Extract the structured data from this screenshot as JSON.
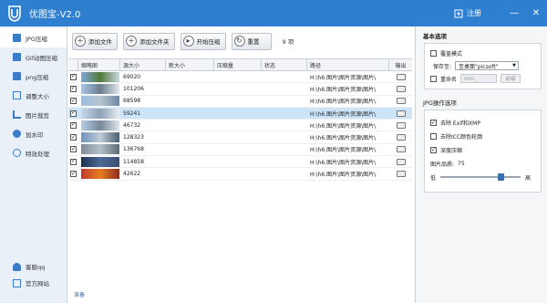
{
  "titlebar": {
    "title": "优图宝-V2.0",
    "register_label": "注册",
    "minimize": "—",
    "close": "✕",
    "bg_color": "#2e7fd0"
  },
  "sidebar": {
    "items": [
      {
        "label": "JPG压缩",
        "icon": "image-icon"
      },
      {
        "label": "Gif动图压缩",
        "icon": "gif-icon"
      },
      {
        "label": "png压缩",
        "icon": "image-icon"
      },
      {
        "label": "调整大小",
        "icon": "resize-icon"
      },
      {
        "label": "图片裁剪",
        "icon": "crop-icon"
      },
      {
        "label": "加水印",
        "icon": "watermark-icon"
      },
      {
        "label": "特效处理",
        "icon": "effect-icon"
      }
    ],
    "bottom": [
      {
        "label": "客服qq",
        "icon": "user-icon"
      },
      {
        "label": "官方网站",
        "icon": "computer-icon"
      }
    ]
  },
  "toolbar": {
    "add_file": "添加文件",
    "add_folder": "添加文件夹",
    "start": "开始压缩",
    "reset": "重置",
    "count": "9 项"
  },
  "table": {
    "headers": [
      "缩略图",
      "源大小",
      "新大小",
      "压缩量",
      "状态",
      "路径",
      "输出"
    ],
    "rows": [
      {
        "src": "69020",
        "path": "H:\\h6.图片\\图片资源\\图片\\"
      },
      {
        "src": "101206",
        "path": "H:\\h6.图片\\图片资源\\图片\\"
      },
      {
        "src": "68598",
        "path": "H:\\h6.图片\\图片资源\\图片\\"
      },
      {
        "src": "59241",
        "path": "H:\\h6.图片\\图片资源\\图片\\"
      },
      {
        "src": "46732",
        "path": "H:\\h6.图片\\图片资源\\图片\\"
      },
      {
        "src": "128323",
        "path": "H:\\h6.图片\\图片资源\\图片\\"
      },
      {
        "src": "136768",
        "path": "H:\\h6.图片\\图片资源\\图片\\"
      },
      {
        "src": "114858",
        "path": "H:\\h6.图片\\图片资源\\图片\\"
      },
      {
        "src": "42622",
        "path": "H:\\h6.图片\\图片资源\\图片\\"
      }
    ]
  },
  "status": "准备",
  "panel": {
    "basic_title": "基本选项",
    "overwrite_label": "覆盖模式",
    "save_to_label": "保存至:",
    "save_to_value": "至桌面\"picsoft\"",
    "rename_label": "重命名",
    "rename_value": "min_",
    "rename_button": "前缀",
    "jpg_title": "JPG操作选项",
    "remove_exif": "去除 Exif和XMP",
    "remove_icc": "去除ICC颜色轮廓",
    "deep_compress": "深度压缩",
    "quality_label": "图片品质:",
    "quality_value": "75",
    "low_label": "低",
    "high_label": "高",
    "quality_fraction": 0.75
  }
}
